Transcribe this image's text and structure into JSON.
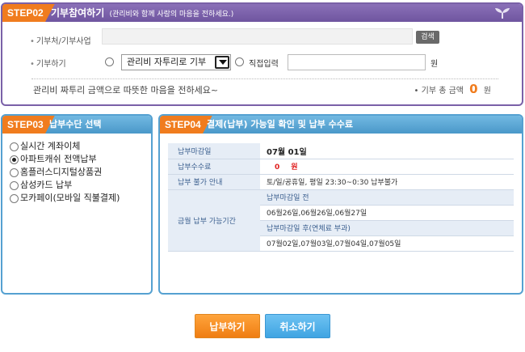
{
  "step02": {
    "badge": "STEP02",
    "title": "기부참여하기",
    "subtitle": "(관리비와 함께 사랑의 마음을 전하세요.)",
    "field_org_label": "기부처/기부사업",
    "field_org_value": "",
    "search_button": "검색",
    "field_donate_label": "기부하기",
    "option_select": "관리비 자투리로 기부",
    "option_direct": "직접입력",
    "direct_value": "",
    "unit": "원",
    "message": "관리비 짜투리 금액으로 따뜻한 마음을 전하세요~",
    "total_label": "기부 총 금액",
    "total_value": "0",
    "total_unit": "원"
  },
  "step03": {
    "badge": "STEP03",
    "title": "납부수단 선택",
    "methods": [
      {
        "label": "실시간 계좌이체",
        "selected": false
      },
      {
        "label": "아파트캐쉬 전액납부",
        "selected": true
      },
      {
        "label": "홈플러스디지털상품권",
        "selected": false
      },
      {
        "label": "삼성카드 납부",
        "selected": false
      },
      {
        "label": "모카페이(모바일 직불결제)",
        "selected": false
      }
    ]
  },
  "step04": {
    "badge": "STEP04",
    "title": "결제(납부) 가능일 확인 및 납부 수수료",
    "due_label": "납부마감일",
    "due_value": "07월 01일",
    "fee_label": "납부수수료",
    "fee_value": "0",
    "fee_unit": "원",
    "unavailable_label": "납부 불가 안내",
    "unavailable_value": "토/일/공휴일, 평일 23:30~0:30 납부불가",
    "period_label": "금월 납부 가능기간",
    "before_label": "납부마감일 전",
    "before_dates": "06월26일,06월26일,06월27일",
    "after_label": "납부마감일 후(연체료 부과)",
    "after_dates": "07월02일,07월03일,07월04일,07월05일"
  },
  "buttons": {
    "pay": "납부하기",
    "cancel": "취소하기"
  },
  "colors": {
    "purple": "#7a61a8",
    "orange": "#f07c1e",
    "blue": "#55a1d1"
  }
}
